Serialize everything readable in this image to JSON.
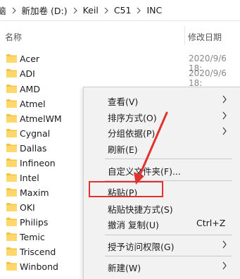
{
  "breadcrumb": [
    {
      "label": "脑"
    },
    {
      "label": "新加卷 (D:)"
    },
    {
      "label": "Keil"
    },
    {
      "label": "C51"
    },
    {
      "label": "INC"
    }
  ],
  "columns": {
    "name": "名称",
    "date": "修改日期"
  },
  "files": [
    {
      "name": "Acer",
      "date": "2020/9/6 18:"
    },
    {
      "name": "ADI",
      "date": "2020/9/6 18:"
    },
    {
      "name": "AMD",
      "date": ""
    },
    {
      "name": "Atmel",
      "date": ""
    },
    {
      "name": "AtmelWM",
      "date": ""
    },
    {
      "name": "Cygnal",
      "date": ""
    },
    {
      "name": "Dallas",
      "date": ""
    },
    {
      "name": "Infineon",
      "date": ""
    },
    {
      "name": "Intel",
      "date": ""
    },
    {
      "name": "Maxim",
      "date": ""
    },
    {
      "name": "OKI",
      "date": ""
    },
    {
      "name": "Philips",
      "date": ""
    },
    {
      "name": "Temic",
      "date": ""
    },
    {
      "name": "Triscend",
      "date": ""
    },
    {
      "name": "Winbond",
      "date": ""
    }
  ],
  "context_menu": {
    "items": [
      {
        "label": "查看(V)",
        "submenu": true
      },
      {
        "label": "排序方式(O)",
        "submenu": true
      },
      {
        "label": "分组依据(P)",
        "submenu": true
      },
      {
        "label": "刷新(E)"
      },
      {
        "label": "自定义文件夹(F)..."
      },
      {
        "label": "粘贴(P)",
        "highlighted": true
      },
      {
        "label": "粘贴快捷方式(S)"
      },
      {
        "label": "撤消 复制(U)",
        "shortcut": "Ctrl+Z"
      },
      {
        "label": "授予访问权限(G)",
        "submenu": true
      },
      {
        "label": "新建(W)",
        "submenu": true
      }
    ]
  },
  "colors": {
    "folder": "#f5c243",
    "highlight_box": "#e0322f",
    "menu_bg": "#f2f2f2"
  }
}
